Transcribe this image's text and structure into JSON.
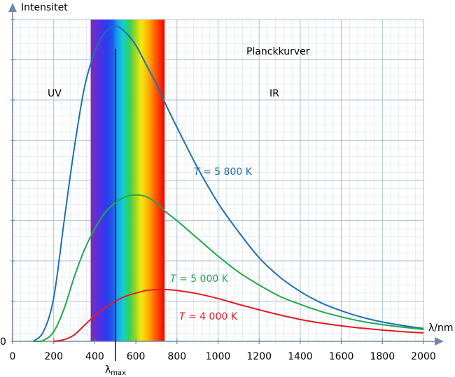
{
  "chart_data": {
    "type": "line",
    "title": "Planckkurver",
    "ylabel": "Intensitet",
    "xlabel": "λ/nm",
    "x_ticks": [
      0,
      200,
      400,
      600,
      800,
      1000,
      1200,
      1400,
      1600,
      1800,
      2000
    ],
    "y_zero_label": "0",
    "xlim": [
      0,
      2000
    ],
    "ylim": [
      0,
      1.0
    ],
    "grid": true,
    "annotations": {
      "uv": "UV",
      "ir": "IR",
      "lambda_max": "λ",
      "lambda_max_sub": "max",
      "lambda_max_x": 500
    },
    "visible_band": [
      380,
      740
    ],
    "series": [
      {
        "name": "T = 5 800 K",
        "label_prefix": "T",
        "label_rest": " = 5 800 K",
        "color": "#1f6fb4",
        "x": [
          100,
          150,
          200,
          250,
          300,
          350,
          400,
          450,
          500,
          550,
          600,
          650,
          700,
          750,
          800,
          900,
          1000,
          1100,
          1200,
          1300,
          1400,
          1500,
          1600,
          1700,
          1800,
          1900,
          2000
        ],
        "y": [
          0.0,
          0.03,
          0.135,
          0.37,
          0.6,
          0.79,
          0.9,
          0.96,
          0.98,
          0.96,
          0.92,
          0.86,
          0.8,
          0.73,
          0.665,
          0.54,
          0.43,
          0.34,
          0.26,
          0.2,
          0.155,
          0.12,
          0.095,
          0.075,
          0.06,
          0.049,
          0.04
        ]
      },
      {
        "name": "T = 5 000 K",
        "label_prefix": "T",
        "label_rest": " = 5 000 K",
        "color": "#22a84a",
        "x": [
          100,
          150,
          200,
          250,
          300,
          350,
          400,
          450,
          500,
          550,
          600,
          650,
          700,
          750,
          800,
          900,
          1000,
          1100,
          1200,
          1300,
          1400,
          1500,
          1600,
          1700,
          1800,
          1900,
          2000
        ],
        "y": [
          0.0,
          0.003,
          0.03,
          0.1,
          0.2,
          0.285,
          0.35,
          0.4,
          0.43,
          0.45,
          0.455,
          0.45,
          0.43,
          0.4,
          0.375,
          0.32,
          0.265,
          0.215,
          0.175,
          0.14,
          0.115,
          0.093,
          0.076,
          0.062,
          0.052,
          0.044,
          0.037
        ]
      },
      {
        "name": "T = 4 000 K",
        "label_prefix": "T",
        "label_rest": " = 4 000 K",
        "color": "#e01b24",
        "x": [
          200,
          250,
          300,
          350,
          400,
          450,
          500,
          550,
          600,
          650,
          700,
          750,
          800,
          900,
          1000,
          1100,
          1200,
          1300,
          1400,
          1500,
          1600,
          1700,
          1800,
          1900,
          2000
        ],
        "y": [
          0.0,
          0.005,
          0.02,
          0.05,
          0.08,
          0.105,
          0.125,
          0.14,
          0.15,
          0.158,
          0.161,
          0.161,
          0.158,
          0.148,
          0.133,
          0.115,
          0.098,
          0.082,
          0.068,
          0.057,
          0.048,
          0.041,
          0.035,
          0.03,
          0.026
        ]
      }
    ]
  }
}
